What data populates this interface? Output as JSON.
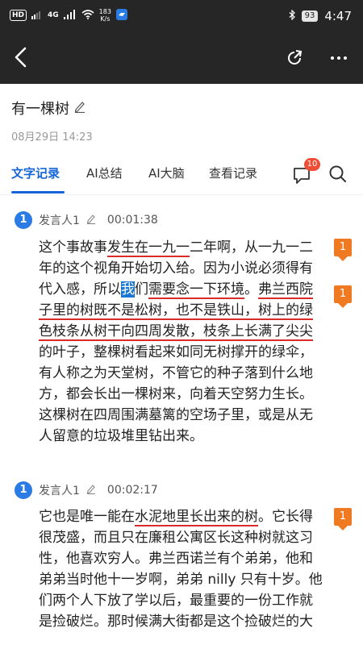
{
  "status": {
    "sim_badge": "HD",
    "network": "4G",
    "speed_value": "183",
    "speed_unit": "K/s",
    "battery": "93",
    "time": "4:47"
  },
  "header": {
    "title": "有一棵树",
    "date": "08月29日 14:23"
  },
  "tabs": [
    {
      "label": "文字记录",
      "active": true
    },
    {
      "label": "AI总结",
      "active": false
    },
    {
      "label": "AI大脑",
      "active": false
    },
    {
      "label": "查看记录",
      "active": false
    }
  ],
  "comment_badge": "10",
  "colors": {
    "accent": "#1565d8",
    "avatar": "#2a7be4",
    "flag": "#f07a22",
    "underline": "#d92b2b",
    "badge": "#ef4d36"
  },
  "segments": [
    {
      "avatar": "1",
      "speaker": "发言人1",
      "time": "00:01:38",
      "p0": "这个事故事",
      "u1": "发生在一九一",
      "p1": "二年啊，从一九一二年的这个视角开始切入给。因为小说必须得有代入感，所以",
      "hl": "我",
      "p2": "们",
      "u2": "需要念一下环境",
      "p3": "。",
      "u3": "弗兰西院子里的树既不是松树，也不是铁山，树上的绿色枝条从树干向四周发散，枝条上长满了尖尖",
      "p4": "的叶子，整棵树看起来如同无树撑开的绿伞，有人称之为天堂树，不管它的种子落到什么地方，都会长出一棵树来，向着天空努力生长。这棵树在四周围满墓篱的空场子里，或是从无人留意的垃圾堆里钻出来。",
      "flags": [
        "1",
        "1"
      ]
    },
    {
      "avatar": "1",
      "speaker": "发言人1",
      "time": "00:02:17",
      "p0": "它也是唯一能在",
      "u1": "水泥地里长出来的树",
      "p1": "。它长得很茂盛，而且只在廉租公寓区长这种树就这习性，他喜欢穷人。弗兰西诺兰有个弟弟，他和弟弟当时他十一岁啊，弟弟 nilly 只有十岁。他们两个人下放了学以后，最重要的一份工作就是捡破烂。那时候满大街都是这个捡破烂的大",
      "flags": [
        "1"
      ]
    }
  ]
}
